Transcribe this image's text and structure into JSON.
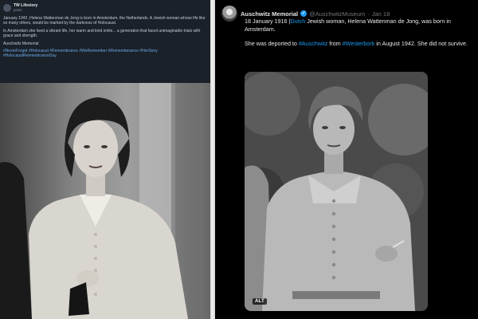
{
  "left_post": {
    "account": "TW Lifestory",
    "sub": "posts",
    "paragraphs": [
      "January 1942 ,Helena Wattenman de Jong is born in Amsterdam, the Netherlands. A Jewish woman whose life like so many others, would be marked by the darkness of Holocaust.",
      "In Amsterdam she lived a vibrant life, her warm and kind smile... a generation that faced unimaginable trials with grace and strength.",
      "Auschwitz Memorial"
    ],
    "links": "#NeverForget #Holocaust #Remembrance #WeRemember #Rememberance #HerStory #HolocaustRemembranceDay"
  },
  "tweet": {
    "author": "Auschwitz Memorial",
    "verified_glyph": "✓",
    "handle": "@AuschwitzMuseum",
    "dot": "·",
    "time": "Jan 18",
    "line1_prefix": "18 January 1916 |",
    "line1_hash": "Dutch",
    "line1_rest": " Jewish woman, Helena Wattenman de Jong, was born in Amsterdam.",
    "line2_prefix": "She was deported to ",
    "line2_hash1": "#Auschwitz",
    "line2_mid": " from ",
    "line2_hash2": "#Westerbork",
    "line2_rest": " in August 1942. She did not survive."
  },
  "media": {
    "alt_label": "ALT"
  },
  "icons": {
    "avatar": "auschwitz-memorial-avatar",
    "verified": "verified-badge-icon"
  },
  "colors": {
    "accent": "#1d9bf0",
    "right_bg": "#000000",
    "left_bg": "#1b2129"
  }
}
